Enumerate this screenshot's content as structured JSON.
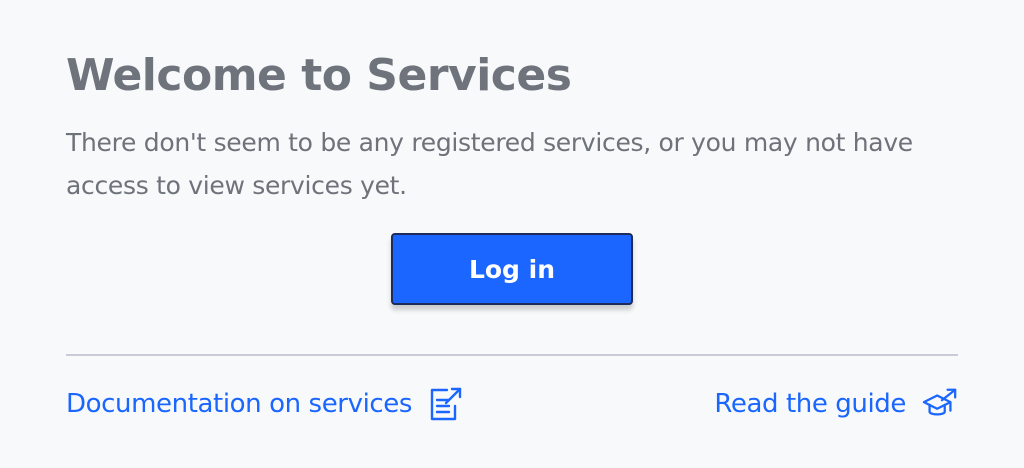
{
  "welcome": {
    "title": "Welcome to Services",
    "description": "There don't seem to be any registered services, or you may not have access to view services yet."
  },
  "login": {
    "label": "Log in"
  },
  "footer": {
    "documentation_label": "Documentation on services",
    "documentation_icon": "document-external-link-icon",
    "guide_label": "Read the guide",
    "guide_icon": "graduation-cap-external-link-icon"
  },
  "colors": {
    "background": "#f8f9fb",
    "heading": "#6f737b",
    "accent": "#1a66ff",
    "button_border": "#1f2c5a",
    "divider": "#c8ccd8"
  }
}
